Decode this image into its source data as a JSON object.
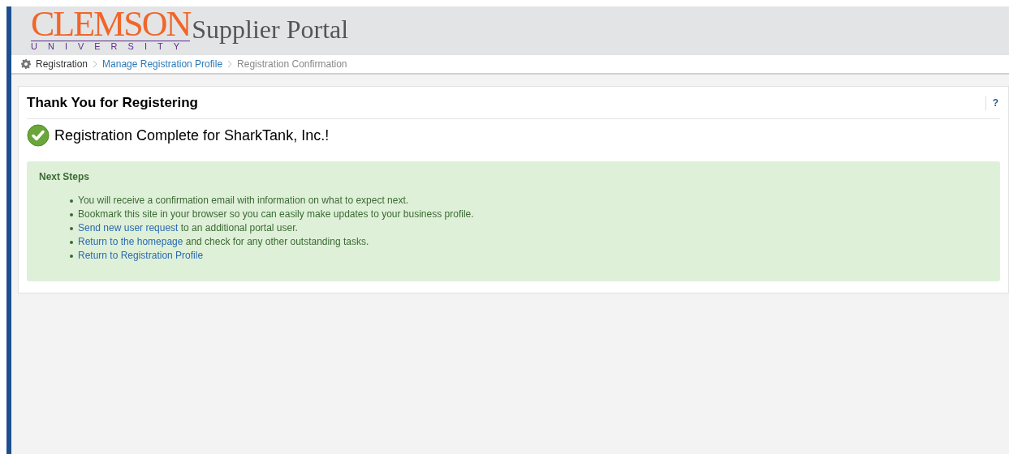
{
  "header": {
    "logo_name": "CLEMSON",
    "logo_sub": "UNIVERSITY",
    "portal_title": "Supplier Portal"
  },
  "breadcrumb": [
    {
      "label": "Registration",
      "kind": "plain"
    },
    {
      "label": "Manage Registration Profile",
      "kind": "link"
    },
    {
      "label": "Registration Confirmation",
      "kind": "current"
    }
  ],
  "panel": {
    "title": "Thank You for Registering",
    "help": "?",
    "message": "Registration Complete for SharkTank, Inc.!",
    "next_steps": {
      "title": "Next Steps",
      "items": [
        {
          "text": "You will receive a confirmation email with information on what to expect next."
        },
        {
          "text": "Bookmark this site in your browser so you can easily make updates to your business profile."
        },
        {
          "link": "Send new user request",
          "text": "to an additional portal user."
        },
        {
          "link": "Return to the homepage",
          "text": "and check for any other outstanding tasks."
        },
        {
          "link": "Return to Registration Profile"
        }
      ]
    }
  }
}
